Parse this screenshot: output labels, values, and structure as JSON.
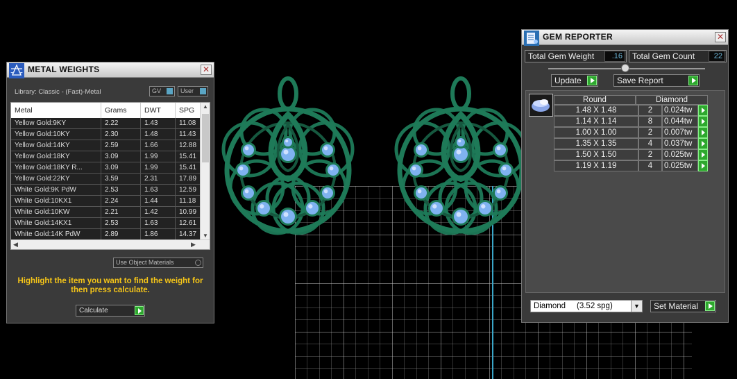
{
  "metal_weights": {
    "title": "METAL WEIGHTS",
    "library": "Library: Classic - (Fast)-Metal",
    "toggle_gv": "GV",
    "toggle_user": "User",
    "columns": [
      "Metal",
      "Grams",
      "DWT",
      "SPG"
    ],
    "rows": [
      [
        "Yellow Gold:9KY",
        "2.22",
        "1.43",
        "11.08"
      ],
      [
        "Yellow Gold:10KY",
        "2.30",
        "1.48",
        "11.43"
      ],
      [
        "Yellow Gold:14KY",
        "2.59",
        "1.66",
        "12.88"
      ],
      [
        "Yellow Gold:18KY",
        "3.09",
        "1.99",
        "15.41"
      ],
      [
        "Yellow Gold:18KY R...",
        "3.09",
        "1.99",
        "15.41"
      ],
      [
        "Yellow Gold:22KY",
        "3.59",
        "2.31",
        "17.89"
      ],
      [
        "White Gold:9K PdW",
        "2.53",
        "1.63",
        "12.59"
      ],
      [
        "White Gold:10KX1",
        "2.24",
        "1.44",
        "11.18"
      ],
      [
        "White Gold:10KW",
        "2.21",
        "1.42",
        "10.99"
      ],
      [
        "White Gold:14KX1",
        "2.53",
        "1.63",
        "12.61"
      ],
      [
        "White Gold:14K PdW",
        "2.89",
        "1.86",
        "14.37"
      ]
    ],
    "use_object_materials": "Use Object Materials",
    "hint": "Highlight the item you want to find the weight for then press calculate.",
    "calculate_label": "Calculate"
  },
  "gem_reporter": {
    "title": "GEM REPORTER",
    "total_gem_weight_label": "Total Gem Weight",
    "total_gem_weight_value": ".16",
    "total_gem_count_label": "Total Gem Count",
    "total_gem_count_value": "22",
    "update_label": "Update",
    "save_report_label": "Save Report",
    "shape_header": "Round",
    "material_header": "Diamond",
    "rows": [
      [
        "1.48 X 1.48",
        "2",
        "0.024tw"
      ],
      [
        "1.14 X 1.14",
        "8",
        "0.044tw"
      ],
      [
        "1.00 X 1.00",
        "2",
        "0.007tw"
      ],
      [
        "1.35 X 1.35",
        "4",
        "0.037tw"
      ],
      [
        "1.50 X 1.50",
        "2",
        "0.025tw"
      ],
      [
        "1.19 X 1.19",
        "4",
        "0.025tw"
      ]
    ],
    "material_select": "Diamond     (3.52 spg)",
    "set_material_label": "Set Material"
  },
  "colors": {
    "viewport_bg": "#000000",
    "metal_green": "#1e7a58",
    "gem_blue": "#7fb2f0",
    "grid_line": "#9a9a9a",
    "axis_line": "#3aa6c8",
    "hint_text": "#f5c518",
    "go_button": "#2ea82e"
  }
}
